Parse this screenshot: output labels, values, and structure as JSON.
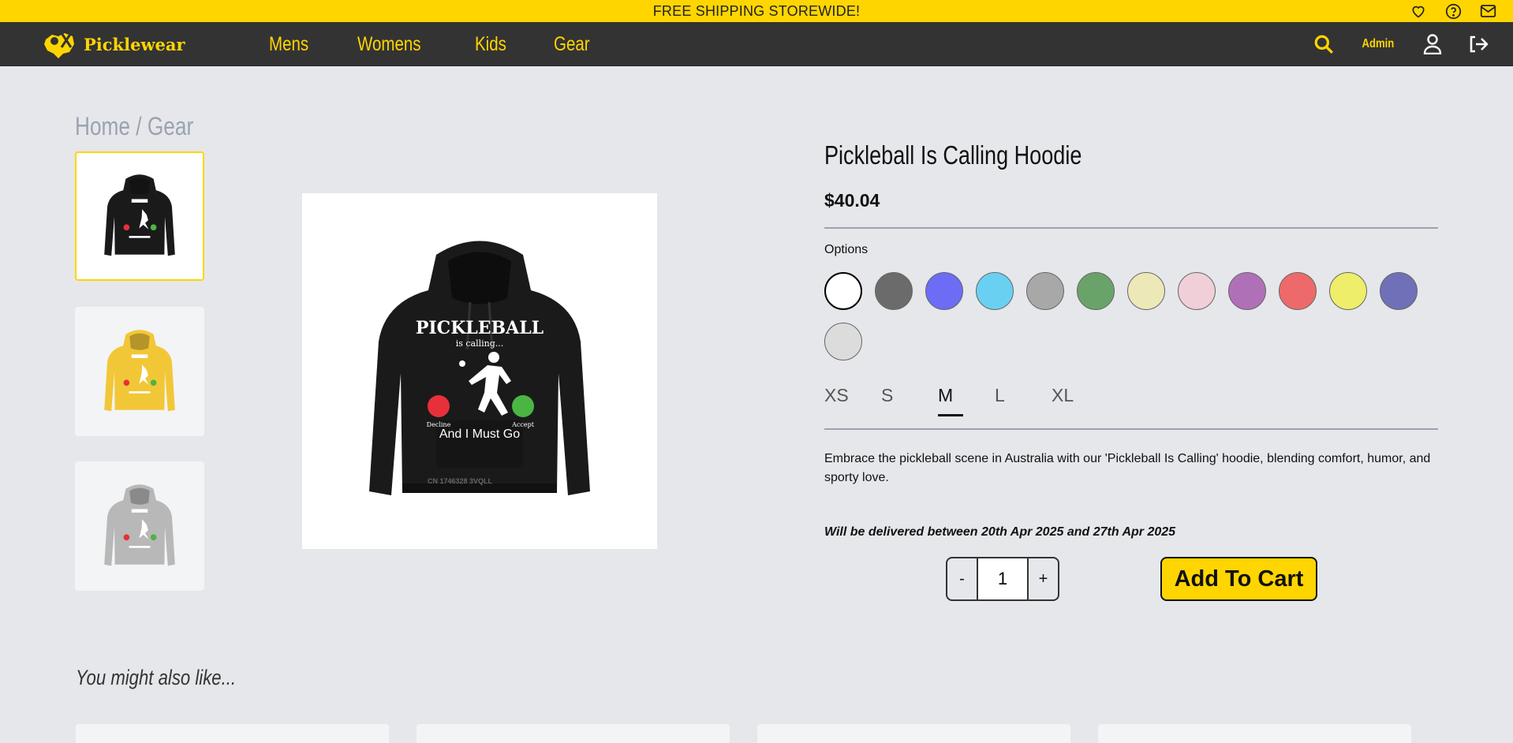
{
  "promo": {
    "text": "FREE SHIPPING STOREWIDE!"
  },
  "brand": {
    "name": "Picklewear"
  },
  "nav": {
    "links": [
      "Mens",
      "Womens",
      "Kids",
      "Gear"
    ],
    "admin": "Admin"
  },
  "breadcrumb": {
    "home": "Home",
    "sep": " / ",
    "current": "Gear"
  },
  "product": {
    "title": "Pickleball Is Calling Hoodie",
    "price": "$40.04",
    "options_label": "Options",
    "colors": [
      "#ffffff",
      "#6b6b6b",
      "#6c6cf5",
      "#6ad0f2",
      "#a8a8a8",
      "#6aa36a",
      "#ece8b8",
      "#f0cfd8",
      "#b070b8",
      "#ee6a6a",
      "#eeee6a",
      "#7070b8",
      "#dcdcdc"
    ],
    "sizes": [
      "XS",
      "S",
      "M",
      "L",
      "XL"
    ],
    "selected_size": "M",
    "description": "Embrace the pickleball scene in Australia with our 'Pickleball Is Calling' hoodie, blending comfort, humor, and sporty love.",
    "delivery": "Will be delivered between 20th Apr 2025 and 27th Apr 2025",
    "quantity": "1",
    "minus": "-",
    "plus": "+",
    "add_to_cart": "Add To Cart"
  },
  "hoodie_print": {
    "headline": "PICKLEBALL",
    "sub": "is calling...",
    "decline": "Decline",
    "accept": "Accept",
    "tagline": "And I Must Go",
    "watermark": "CN 1746328 3VQLL"
  },
  "thumbnail_colors": [
    "#1a1a1a",
    "#f2c737",
    "#b8b8b8"
  ],
  "related": {
    "heading": "You might also like..."
  }
}
